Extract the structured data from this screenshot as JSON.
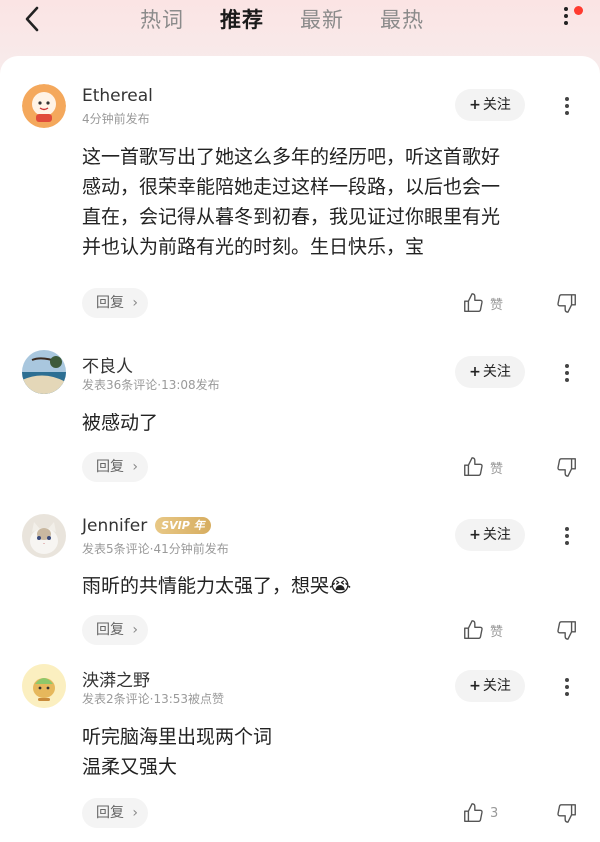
{
  "header": {
    "tabs": [
      {
        "label": "热词"
      },
      {
        "label": "推荐"
      },
      {
        "label": "最新"
      },
      {
        "label": "最热"
      }
    ]
  },
  "comments": [
    {
      "name": "Ethereal",
      "meta": "4分钟前发布",
      "lines": [
        "这一首歌写出了她这么多年的经历吧，听这首歌好",
        "感动，很荣幸能陪她走过这样一段路，以后也会一",
        "直在，会记得从暮冬到初春，我见证过你眼里有光",
        "并也认为前路有光的时刻。生日快乐，宝"
      ],
      "follow": "关注",
      "reply": "回复",
      "like": "赞"
    },
    {
      "name": "不良人",
      "meta": "发表36条评论·13:08发布",
      "lines": [
        "被感动了"
      ],
      "follow": "关注",
      "reply": "回复",
      "like": "赞"
    },
    {
      "name": "Jennifer",
      "badge": "SVIP 年",
      "meta": "发表5条评论·41分钟前发布",
      "lines": [
        "雨昕的共情能力太强了，想哭😭"
      ],
      "follow": "关注",
      "reply": "回复",
      "like": "赞"
    },
    {
      "name": "泱漭之野",
      "meta": "发表2条评论·13:53被点赞",
      "lines": [
        "听完脑海里出现两个词",
        "温柔又强大"
      ],
      "follow": "关注",
      "reply": "回复",
      "like": "3"
    }
  ],
  "colors": {
    "accent_red": "#ff3b30",
    "svip_gold": "#d7ad60"
  }
}
